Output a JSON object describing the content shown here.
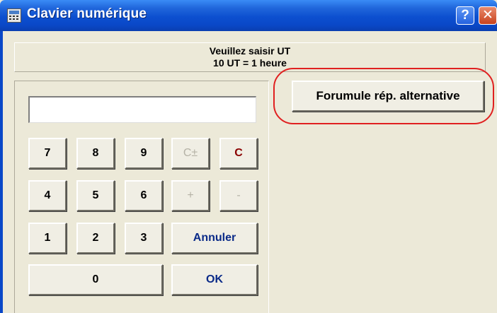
{
  "window": {
    "title": "Clavier numérique",
    "help_label": "?",
    "close_label": "✕",
    "icon": "calculator-icon"
  },
  "info": {
    "line1": "Veuillez saisir UT",
    "line2": "10 UT = 1 heure"
  },
  "display": {
    "value": ""
  },
  "keys": {
    "k7": "7",
    "k8": "8",
    "k9": "9",
    "cpm": "C±",
    "c": "C",
    "k4": "4",
    "k5": "5",
    "k6": "6",
    "plus": "+",
    "minus": "-",
    "k1": "1",
    "k2": "2",
    "k3": "3",
    "annuler": "Annuler",
    "k0": "0",
    "ok": "OK"
  },
  "alternative": {
    "label": "Forumule rép. alternative"
  },
  "colors": {
    "titlebar": "#0a48c8",
    "background": "#ece9d8",
    "highlight_circle": "#e02020",
    "clear_key": "#8a0000",
    "annuler_key": "#0a2a88"
  }
}
